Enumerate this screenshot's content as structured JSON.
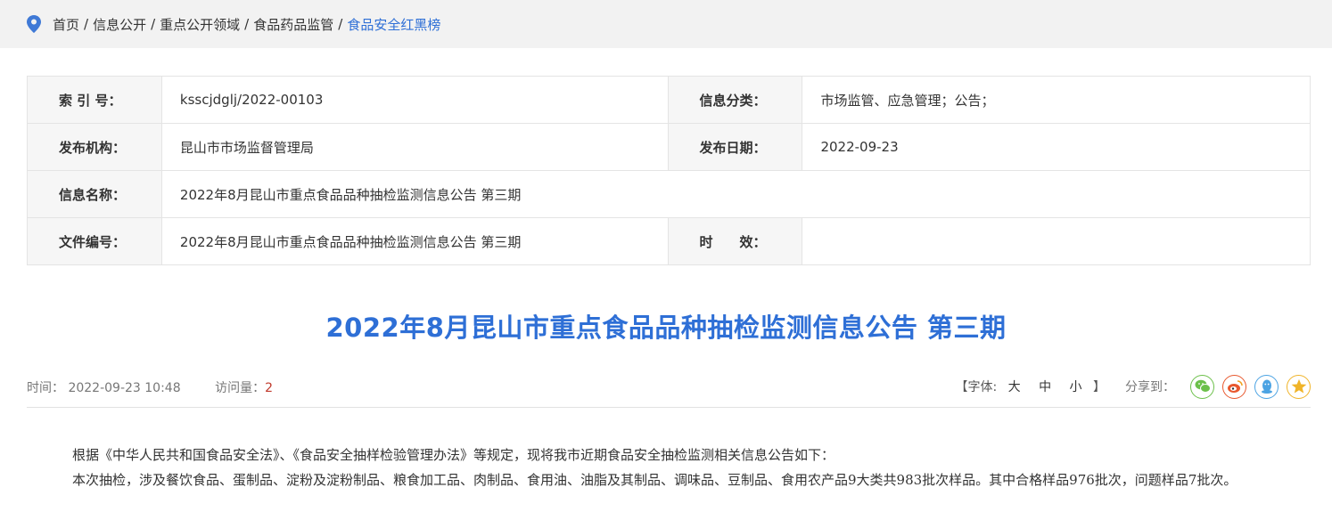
{
  "breadcrumb": {
    "items": [
      "首页",
      "信息公开",
      "重点公开领域",
      "食品药品监管",
      "食品安全红黑榜"
    ],
    "separator": "/"
  },
  "meta": {
    "index_label": "索 引 号：",
    "index_value": "ksscjdglj/2022-00103",
    "category_label": "信息分类：",
    "category_value": "市场监管、应急管理；公告；",
    "publisher_label": "发布机构：",
    "publisher_value": "昆山市市场监督管理局",
    "date_label": "发布日期：",
    "date_value": "2022-09-23",
    "name_label": "信息名称：",
    "name_value": "2022年8月昆山市重点食品品种抽检监测信息公告 第三期",
    "docno_label": "文件编号：",
    "docno_value": "2022年8月昆山市重点食品品种抽检监测信息公告 第三期",
    "validity_label": "时　　效：",
    "validity_value": ""
  },
  "article": {
    "title": "2022年8月昆山市重点食品品种抽检监测信息公告 第三期",
    "time_label": "时间：",
    "time_value": "2022-09-23 10:48",
    "visits_label": "访问量：",
    "visits_value": "2",
    "font_open": "【字体:",
    "font_large": "大",
    "font_medium": "中",
    "font_small": "小",
    "font_close": "】",
    "share_label": "分享到：",
    "paragraphs": [
      "根据《中华人民共和国食品安全法》、《食品安全抽样检验管理办法》等规定，现将我市近期食品安全抽检监测相关信息公告如下：",
      "本次抽检，涉及餐饮食品、蛋制品、淀粉及淀粉制品、粮食加工品、肉制品、食用油、油脂及其制品、调味品、豆制品、食用农产品9大类共983批次样品。其中合格样品976批次，问题样品7批次。"
    ]
  },
  "colors": {
    "accent": "#2e6fd6",
    "visits": "#c0392b",
    "wechat": "#6cc04a",
    "weibo": "#e8582e",
    "qq": "#4ba3e3",
    "qzone": "#f0b429"
  },
  "icons": {
    "location": "location-pin-icon",
    "wechat": "wechat-icon",
    "weibo": "weibo-icon",
    "qq": "qq-icon",
    "qzone": "qzone-star-icon"
  }
}
